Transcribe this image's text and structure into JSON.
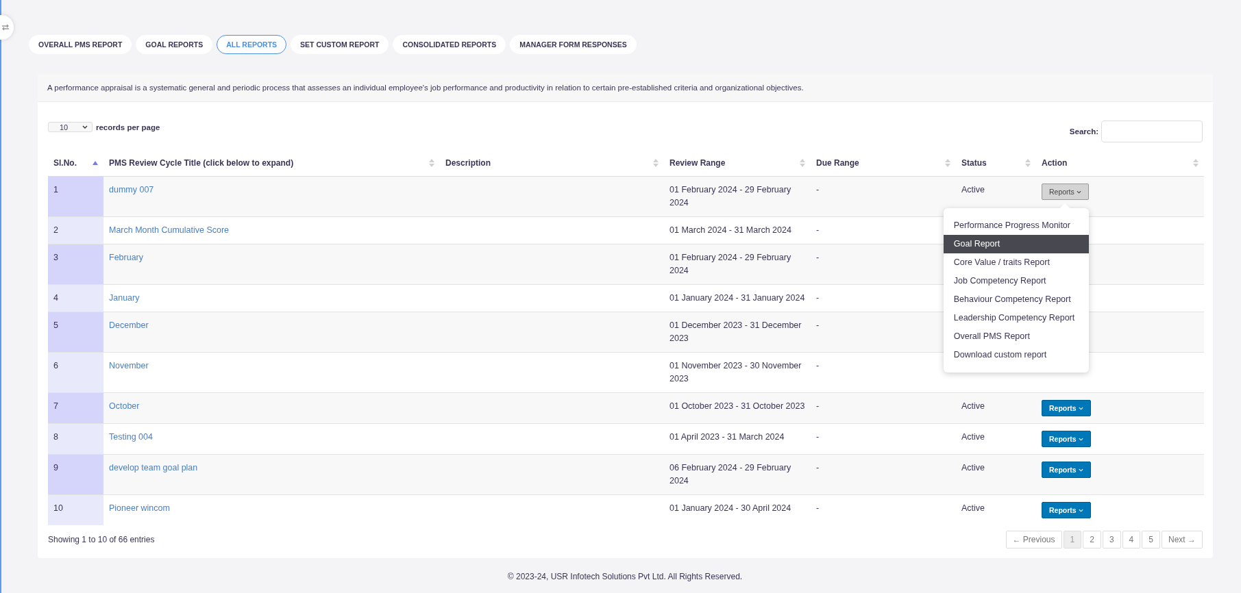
{
  "tabs": [
    {
      "label": "OVERALL PMS REPORT",
      "selected": false
    },
    {
      "label": "GOAL REPORTS",
      "selected": false
    },
    {
      "label": "ALL REPORTS",
      "selected": true
    },
    {
      "label": "SET CUSTOM REPORT",
      "selected": false
    },
    {
      "label": "CONSOLIDATED REPORTS",
      "selected": false
    },
    {
      "label": "MANAGER FORM RESPONSES",
      "selected": false
    }
  ],
  "intro": "A performance appraisal is a systematic general and periodic process that assesses an individual employee's job performance and productivity in relation to certain pre-established criteria and organizational objectives.",
  "page_size": {
    "value": "10",
    "label": "records per page"
  },
  "search": {
    "label": "Search:"
  },
  "table": {
    "columns": [
      {
        "label": "Sl.No.",
        "sorted": true
      },
      {
        "label": "PMS Review Cycle Title (click below to expand)",
        "sorted": false
      },
      {
        "label": "Description",
        "sorted": false
      },
      {
        "label": "Review Range",
        "sorted": false
      },
      {
        "label": "Due Range",
        "sorted": false
      },
      {
        "label": "Status",
        "sorted": false
      },
      {
        "label": "Action",
        "sorted": false
      }
    ],
    "rows": [
      {
        "sl": "1",
        "title": "dummy 007",
        "review_range": "01 February 2024 - 29 February 2024",
        "due_range": "-",
        "status": "Active",
        "action": {
          "label": "Reports",
          "expanded": true
        }
      },
      {
        "sl": "2",
        "title": "March Month Cumulative Score",
        "review_range": "01 March 2024 - 31 March 2024",
        "due_range": "-"
      },
      {
        "sl": "3",
        "title": "February",
        "review_range": "01 February 2024 - 29 February 2024",
        "due_range": "-"
      },
      {
        "sl": "4",
        "title": "January",
        "review_range": "01 January 2024 - 31 January 2024",
        "due_range": "-"
      },
      {
        "sl": "5",
        "title": "December",
        "review_range": "01 December 2023 - 31 December 2023",
        "due_range": "-"
      },
      {
        "sl": "6",
        "title": "November",
        "review_range": "01 November 2023 - 30 November 2023",
        "due_range": "-"
      },
      {
        "sl": "7",
        "title": "October",
        "review_range": "01 October 2023 - 31 October 2023",
        "due_range": "-",
        "status": "Active",
        "action": {
          "label": "Reports",
          "expanded": false
        }
      },
      {
        "sl": "8",
        "title": "Testing 004",
        "review_range": "01 April 2023 - 31 March 2024",
        "due_range": "-",
        "status": "Active",
        "action": {
          "label": "Reports",
          "expanded": false
        }
      },
      {
        "sl": "9",
        "title": "develop team goal plan",
        "review_range": "06 February 2024 - 29 February 2024",
        "due_range": "-",
        "status": "Active",
        "action": {
          "label": "Reports",
          "expanded": false
        }
      },
      {
        "sl": "10",
        "title": "Pioneer wincom",
        "review_range": "01 January 2024 - 30 April 2024",
        "due_range": "-",
        "status": "Active",
        "action": {
          "label": "Reports",
          "expanded": false
        }
      }
    ]
  },
  "reports_menu": {
    "items": [
      {
        "label": "Performance Progress Monitor",
        "selected": false
      },
      {
        "label": "Goal Report",
        "selected": true
      },
      {
        "label": "Core Value / traits Report",
        "selected": false
      },
      {
        "label": "Job Competency Report",
        "selected": false
      },
      {
        "label": "Behaviour Competency Report",
        "selected": false
      },
      {
        "label": "Leadership Competency Report",
        "selected": false
      },
      {
        "label": "Overall PMS Report",
        "selected": false
      },
      {
        "label": "Download custom report",
        "selected": false
      }
    ]
  },
  "info": "Showing 1 to 10 of 66 entries",
  "pagination": [
    {
      "label": "← Previous",
      "selected": false
    },
    {
      "label": "1",
      "selected": true
    },
    {
      "label": "2",
      "selected": false
    },
    {
      "label": "3",
      "selected": false
    },
    {
      "label": "4",
      "selected": false
    },
    {
      "label": "5",
      "selected": false
    },
    {
      "label": "Next →",
      "selected": false
    }
  ],
  "footer": "© 2023-24, USR Infotech Solutions Pvt Ltd. All Rights Reserved."
}
